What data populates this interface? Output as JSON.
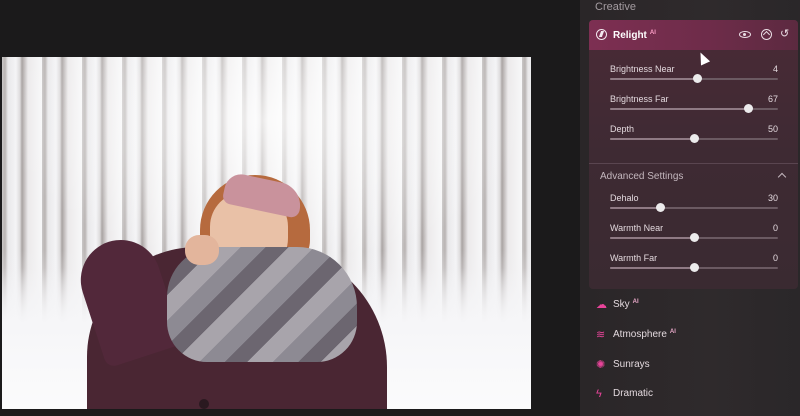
{
  "sidebar": {
    "section_title": "Creative",
    "relight": {
      "title": "Relight",
      "ai_badge": "AI",
      "sliders": [
        {
          "label": "Brightness Near",
          "value": "4",
          "fraction": 0.52
        },
        {
          "label": "Brightness Far",
          "value": "67",
          "fraction": 0.82
        },
        {
          "label": "Depth",
          "value": "50",
          "fraction": 0.5
        }
      ],
      "advanced": {
        "title": "Advanced Settings",
        "sliders": [
          {
            "label": "Dehalo",
            "value": "30",
            "fraction": 0.3
          },
          {
            "label": "Warmth Near",
            "value": "0",
            "fraction": 0.5
          },
          {
            "label": "Warmth Far",
            "value": "0",
            "fraction": 0.5
          }
        ]
      }
    },
    "tools": [
      {
        "label": "Sky",
        "ai_badge": "AI",
        "icon": "cloud-icon"
      },
      {
        "label": "Atmosphere",
        "ai_badge": "AI",
        "icon": "waves-icon"
      },
      {
        "label": "Sunrays",
        "ai_badge": "",
        "icon": "sun-icon"
      },
      {
        "label": "Dramatic",
        "ai_badge": "",
        "icon": "lightning-icon"
      }
    ]
  },
  "colors": {
    "accent": "#e8449a",
    "panel_header": "#7d2f52",
    "background": "#1d1b1d"
  }
}
